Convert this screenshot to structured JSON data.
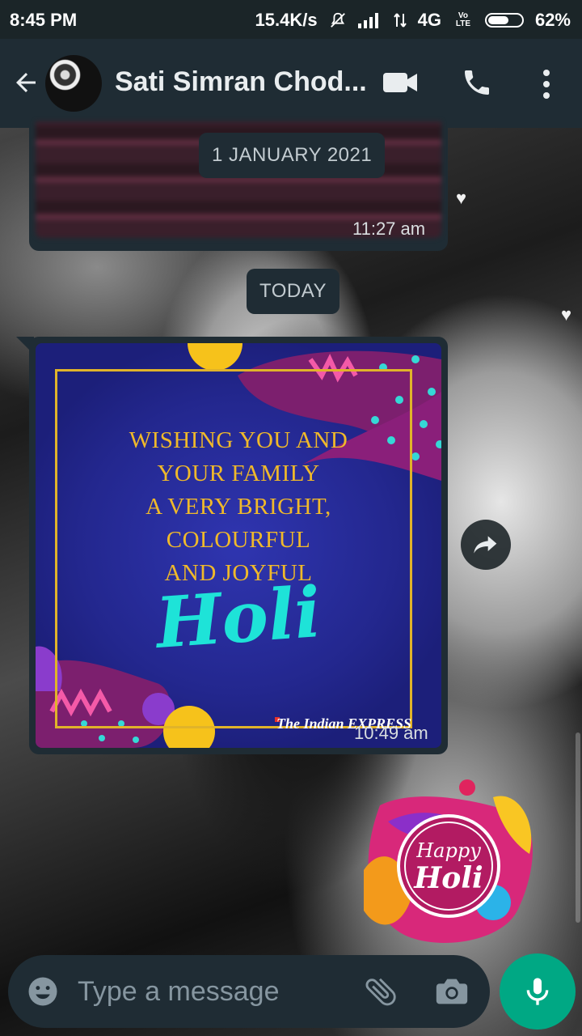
{
  "status_bar": {
    "time": "8:45 PM",
    "net_speed": "15.4K/s",
    "network": "4G",
    "volte": "Vo LTE",
    "battery": "62%",
    "battery_level": 0.62
  },
  "header": {
    "contact_name": "Sati Simran Chod...",
    "icons": [
      "back-arrow-icon",
      "video-call-icon",
      "voice-call-icon",
      "more-vert-icon"
    ]
  },
  "chat": {
    "date_chip_1": "1 JANUARY 2021",
    "message_1_time": "11:27 am",
    "date_chip_2": "TODAY",
    "message_2": {
      "card_lines": [
        "WISHING YOU AND",
        "YOUR FAMILY",
        "A VERY BRIGHT,",
        "COLOURFUL",
        "AND JOYFUL"
      ],
      "card_holi": "Holi",
      "card_brand": "The Indian EXPRESS",
      "time": "10:49 am"
    },
    "sticker": {
      "text_line_1": "Happy",
      "text_line_2": "Holi"
    }
  },
  "composer": {
    "placeholder": "Type a message",
    "icons": [
      "emoji-icon",
      "attach-icon",
      "camera-icon",
      "mic-icon"
    ]
  },
  "colors": {
    "header_bg": "#1f2c34",
    "statusbar_bg": "#1b2528",
    "accent_green": "#00a884",
    "card_gold": "#e0b32a",
    "card_teal": "#1ee3d8"
  }
}
